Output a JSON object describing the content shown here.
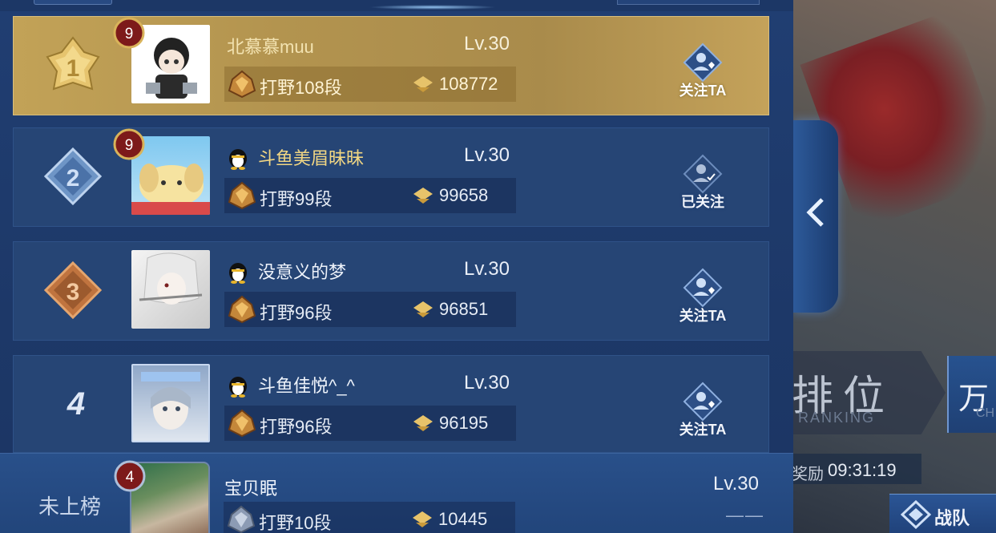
{
  "leaderboard": {
    "rows": [
      {
        "rank": "1",
        "name": "北慕慕muu",
        "level": "Lv.30",
        "badge_level": "9",
        "tier": "打野108段",
        "score": "108772",
        "action": "关注TA",
        "highlighted": true,
        "has_qq_icon": false
      },
      {
        "rank": "2",
        "name": "斗鱼美眉昧昧",
        "level": "Lv.30",
        "badge_level": "9",
        "tier": "打野99段",
        "score": "99658",
        "action": "已关注",
        "highlighted": false,
        "has_qq_icon": true
      },
      {
        "rank": "3",
        "name": "没意义的梦",
        "level": "Lv.30",
        "badge_level": "",
        "tier": "打野96段",
        "score": "96851",
        "action": "关注TA",
        "highlighted": false,
        "has_qq_icon": true
      },
      {
        "rank": "4",
        "name": "斗鱼佳悦^_^",
        "level": "Lv.30",
        "badge_level": "",
        "tier": "打野96段",
        "score": "96195",
        "action": "关注TA",
        "highlighted": false,
        "has_qq_icon": true
      }
    ],
    "self": {
      "rank_text": "未上榜",
      "name": "宝贝眠",
      "level": "Lv.30",
      "badge_level": "4",
      "tier": "打野10段",
      "score": "10445",
      "action": "——"
    }
  },
  "backdrop": {
    "mode_title": "排位",
    "mode_title_en": "RANKING",
    "side_title": "万",
    "side_sub": "CH",
    "timer_label": "奖励",
    "timer": "09:31:19",
    "team_label": "战队"
  },
  "colors": {
    "panel_bg": "#1d3868",
    "row_bg": "#264575",
    "gold_row": "#b3944f",
    "name_gold": "#f1d683",
    "rank1": "#d9b35a",
    "rank2": "#8fb4dc",
    "rank3": "#c0743f"
  },
  "icons": {
    "rank_badge": "laurel-rank-badge-icon",
    "level_badge": "red-level-badge-icon",
    "qq": "qq-penguin-icon",
    "tier": "jungle-tier-emblem-icon",
    "score": "score-chevron-icon",
    "follow": "follow-user-heart-icon",
    "collapse": "chevron-left-icon",
    "team": "team-icon"
  }
}
